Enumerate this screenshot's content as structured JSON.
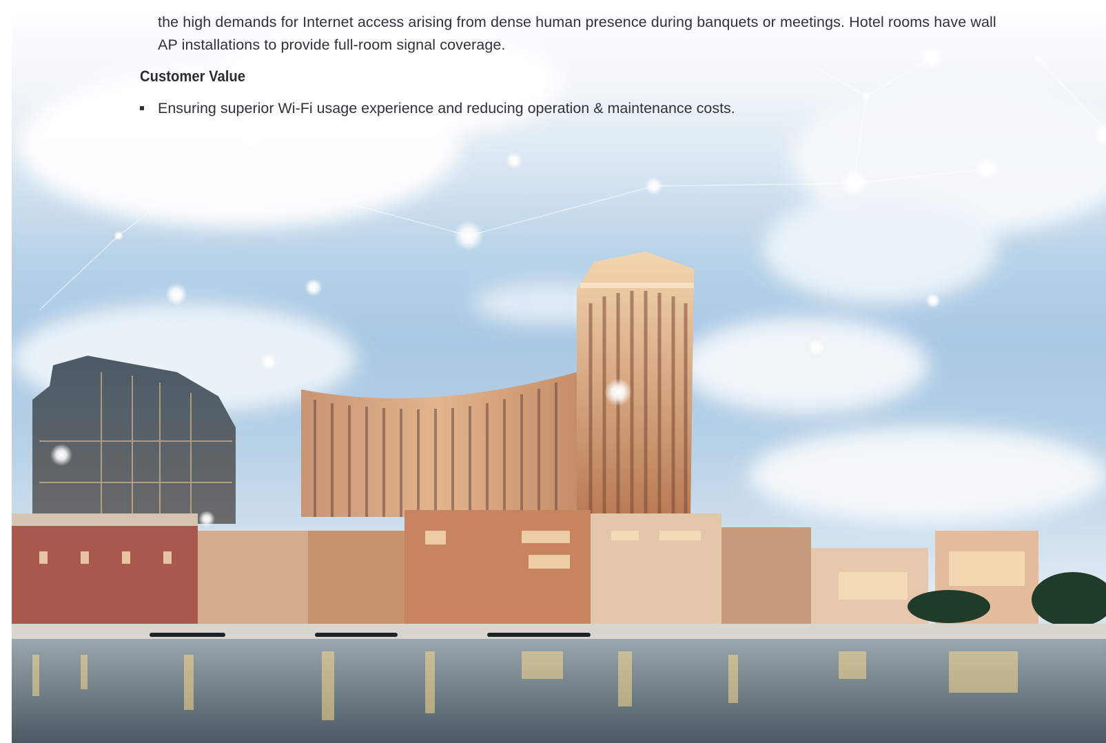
{
  "body": {
    "paragraph_tail": "the high demands for Internet access arising from dense human presence during banquets or meetings. Hotel rooms have wall AP installations to provide full-room signal coverage."
  },
  "customer_value": {
    "title": "Customer Value",
    "bullets": [
      "Ensuring superior Wi-Fi usage experience and reducing operation & maintenance costs."
    ]
  },
  "photo": {
    "subject": "hotel-resort-skyline-photo",
    "palette": {
      "sky": "#a9c8e3",
      "cloud": "#ffffff",
      "building_light": "#e8b98a",
      "building_dark": "#7a4a35",
      "water": "#5f6c73",
      "node_glow": "#ffffff"
    }
  }
}
